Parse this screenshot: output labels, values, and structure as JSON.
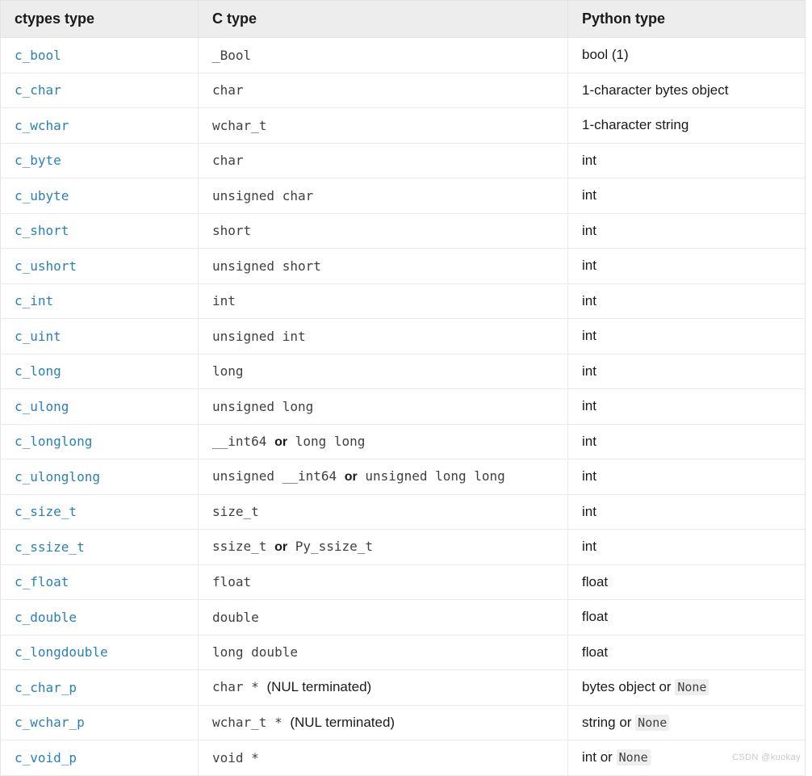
{
  "table": {
    "columns": [
      {
        "key": "ctypes_type",
        "label": "ctypes type"
      },
      {
        "key": "c_type",
        "label": "C type"
      },
      {
        "key": "python_type",
        "label": "Python type"
      }
    ],
    "rows": [
      {
        "ctypes_type": "c_bool",
        "c_type_parts": [
          {
            "text": "_Bool",
            "style": "code"
          }
        ],
        "python_type_parts": [
          {
            "text": "bool (1)",
            "style": "plain"
          }
        ]
      },
      {
        "ctypes_type": "c_char",
        "c_type_parts": [
          {
            "text": "char",
            "style": "code"
          }
        ],
        "python_type_parts": [
          {
            "text": "1-character bytes object",
            "style": "plain"
          }
        ]
      },
      {
        "ctypes_type": "c_wchar",
        "c_type_parts": [
          {
            "text": "wchar_t",
            "style": "code"
          }
        ],
        "python_type_parts": [
          {
            "text": "1-character string",
            "style": "plain"
          }
        ]
      },
      {
        "ctypes_type": "c_byte",
        "c_type_parts": [
          {
            "text": "char",
            "style": "code"
          }
        ],
        "python_type_parts": [
          {
            "text": "int",
            "style": "plain"
          }
        ]
      },
      {
        "ctypes_type": "c_ubyte",
        "c_type_parts": [
          {
            "text": "unsigned char",
            "style": "code"
          }
        ],
        "python_type_parts": [
          {
            "text": "int",
            "style": "plain"
          }
        ]
      },
      {
        "ctypes_type": "c_short",
        "c_type_parts": [
          {
            "text": "short",
            "style": "code"
          }
        ],
        "python_type_parts": [
          {
            "text": "int",
            "style": "plain"
          }
        ]
      },
      {
        "ctypes_type": "c_ushort",
        "c_type_parts": [
          {
            "text": "unsigned short",
            "style": "code"
          }
        ],
        "python_type_parts": [
          {
            "text": "int",
            "style": "plain"
          }
        ]
      },
      {
        "ctypes_type": "c_int",
        "c_type_parts": [
          {
            "text": "int",
            "style": "code"
          }
        ],
        "python_type_parts": [
          {
            "text": "int",
            "style": "plain"
          }
        ]
      },
      {
        "ctypes_type": "c_uint",
        "c_type_parts": [
          {
            "text": "unsigned int",
            "style": "code"
          }
        ],
        "python_type_parts": [
          {
            "text": "int",
            "style": "plain"
          }
        ]
      },
      {
        "ctypes_type": "c_long",
        "c_type_parts": [
          {
            "text": "long",
            "style": "code"
          }
        ],
        "python_type_parts": [
          {
            "text": "int",
            "style": "plain"
          }
        ]
      },
      {
        "ctypes_type": "c_ulong",
        "c_type_parts": [
          {
            "text": "unsigned long",
            "style": "code"
          }
        ],
        "python_type_parts": [
          {
            "text": "int",
            "style": "plain"
          }
        ]
      },
      {
        "ctypes_type": "c_longlong",
        "c_type_parts": [
          {
            "text": "__int64",
            "style": "code"
          },
          {
            "text": "or",
            "style": "conj"
          },
          {
            "text": "long long",
            "style": "code"
          }
        ],
        "python_type_parts": [
          {
            "text": "int",
            "style": "plain"
          }
        ]
      },
      {
        "ctypes_type": "c_ulonglong",
        "c_type_parts": [
          {
            "text": "unsigned __int64",
            "style": "code"
          },
          {
            "text": "or",
            "style": "conj"
          },
          {
            "text": "unsigned long long",
            "style": "code"
          }
        ],
        "python_type_parts": [
          {
            "text": "int",
            "style": "plain"
          }
        ]
      },
      {
        "ctypes_type": "c_size_t",
        "c_type_parts": [
          {
            "text": "size_t",
            "style": "code"
          }
        ],
        "python_type_parts": [
          {
            "text": "int",
            "style": "plain"
          }
        ]
      },
      {
        "ctypes_type": "c_ssize_t",
        "c_type_parts": [
          {
            "text": "ssize_t",
            "style": "code"
          },
          {
            "text": "or",
            "style": "conj"
          },
          {
            "text": "Py_ssize_t",
            "style": "code"
          }
        ],
        "python_type_parts": [
          {
            "text": "int",
            "style": "plain"
          }
        ]
      },
      {
        "ctypes_type": "c_float",
        "c_type_parts": [
          {
            "text": "float",
            "style": "code"
          }
        ],
        "python_type_parts": [
          {
            "text": "float",
            "style": "plain"
          }
        ]
      },
      {
        "ctypes_type": "c_double",
        "c_type_parts": [
          {
            "text": "double",
            "style": "code"
          }
        ],
        "python_type_parts": [
          {
            "text": "float",
            "style": "plain"
          }
        ]
      },
      {
        "ctypes_type": "c_longdouble",
        "c_type_parts": [
          {
            "text": "long double",
            "style": "code"
          }
        ],
        "python_type_parts": [
          {
            "text": "float",
            "style": "plain"
          }
        ]
      },
      {
        "ctypes_type": "c_char_p",
        "c_type_parts": [
          {
            "text": "char *",
            "style": "code"
          },
          {
            "text": "(NUL terminated)",
            "style": "plain"
          }
        ],
        "python_type_parts": [
          {
            "text": "bytes object",
            "style": "plain"
          },
          {
            "text": "or",
            "style": "conj"
          },
          {
            "text": "None",
            "style": "code-lit"
          }
        ]
      },
      {
        "ctypes_type": "c_wchar_p",
        "c_type_parts": [
          {
            "text": "wchar_t *",
            "style": "code"
          },
          {
            "text": "(NUL terminated)",
            "style": "plain"
          }
        ],
        "python_type_parts": [
          {
            "text": "string",
            "style": "plain"
          },
          {
            "text": "or",
            "style": "conj"
          },
          {
            "text": "None",
            "style": "code-lit"
          }
        ]
      },
      {
        "ctypes_type": "c_void_p",
        "c_type_parts": [
          {
            "text": "void *",
            "style": "code"
          }
        ],
        "python_type_parts": [
          {
            "text": "int",
            "style": "plain"
          },
          {
            "text": "or",
            "style": "conj"
          },
          {
            "text": "None",
            "style": "code-lit"
          }
        ]
      }
    ]
  },
  "watermark": {
    "text": "CSDN @kuokay"
  },
  "colors": {
    "link": "#2980b9",
    "header_bg": "#ededed",
    "border": "#e1e4e5",
    "body_text": "#1a1a1a",
    "code_text": "#404040",
    "inline_code_bg": "#eeeeee",
    "watermark": "#c9c9c9"
  }
}
